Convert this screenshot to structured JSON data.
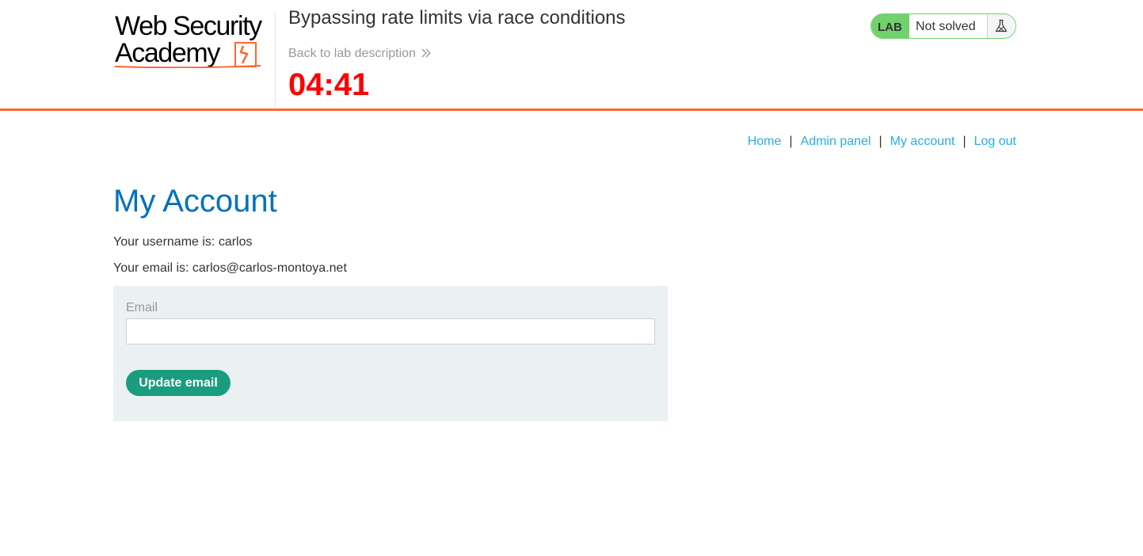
{
  "header": {
    "logo_line1": "Web Security",
    "logo_line2": "Academy",
    "lab_title": "Bypassing rate limits via race conditions",
    "back_link": "Back to lab description",
    "timer": "04:41",
    "lab_status": {
      "tag": "LAB",
      "status": "Not solved",
      "icon": "flask-icon"
    }
  },
  "nav": {
    "items": [
      {
        "label": "Home"
      },
      {
        "label": "Admin panel"
      },
      {
        "label": "My account"
      },
      {
        "label": "Log out"
      }
    ],
    "separator": "|"
  },
  "main": {
    "title": "My Account",
    "username_line": "Your username is: carlos",
    "email_line": "Your email is: carlos@carlos-montoya.net",
    "form": {
      "email_label": "Email",
      "email_value": "",
      "submit_label": "Update email"
    }
  },
  "colors": {
    "accent_orange": "#ff6633",
    "title_blue": "#0071bc",
    "link_blue": "#29ace5",
    "timer_red": "#ff0000",
    "lab_green": "#70d16d",
    "button_green": "#1a9c7f"
  }
}
